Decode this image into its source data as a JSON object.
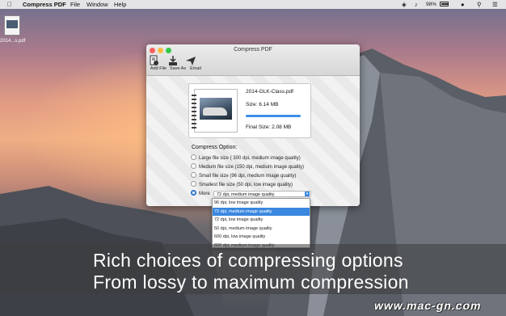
{
  "menubar": {
    "app": "Compress PDF",
    "items": [
      "File",
      "Window",
      "Help"
    ],
    "battery": "98%"
  },
  "desktop": {
    "icon_label": "2014...s.pdf"
  },
  "window": {
    "title": "Compress PDF",
    "toolbar": [
      {
        "label": "Add File",
        "icon": "add-file-icon"
      },
      {
        "label": "Save As",
        "icon": "save-as-icon"
      },
      {
        "label": "Email",
        "icon": "email-icon"
      }
    ],
    "file": {
      "name": "2014-GLK-Class.pdf",
      "size": "Size: 6.14 MB",
      "final_size": "Final Size: 2.08 MB",
      "progress": 1.0
    },
    "options_title": "Compress Option:",
    "options": [
      {
        "label": "Large file size ( 300 dpi, medium image quality)",
        "selected": false
      },
      {
        "label": "Medium file size (150 dpi, medium image quality)",
        "selected": false
      },
      {
        "label": "Small file size (96 dpi, medium image quality)",
        "selected": false
      },
      {
        "label": "Smallest file size (50 dpi, low image quality)",
        "selected": false
      },
      {
        "label": "More",
        "selected": true
      }
    ],
    "more_select_value": "72 dpi, medium image quality",
    "dropdown": [
      "96 dpi, low image quality",
      "72 dpi, medium image quality",
      "72 dpi, low image quality",
      "50 dpi, medium image quality",
      "600 dpi, low image quality",
      "600 dpi, medium image quality"
    ],
    "dropdown_selected_index": 1
  },
  "caption": {
    "line1": "Rich choices of compressing options",
    "line2": "From lossy to maximum compression"
  },
  "watermark": "www.mac-gn.com"
}
